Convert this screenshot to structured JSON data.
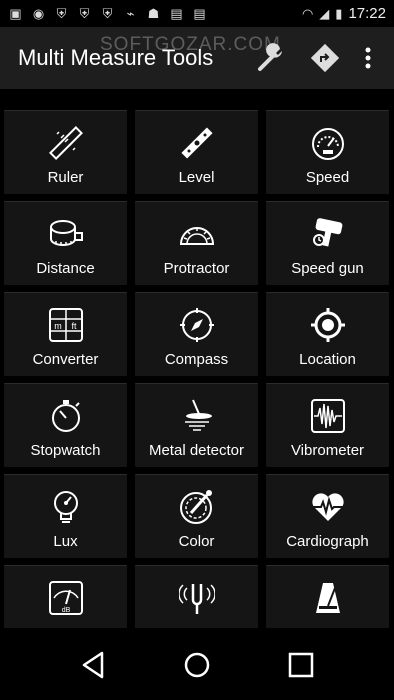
{
  "status_bar": {
    "time": "17:22"
  },
  "app_bar": {
    "title": "Multi Measure Tools",
    "watermark": "SOFTGOZAR.COM"
  },
  "tools": [
    {
      "label": "Ruler",
      "icon": "ruler-icon"
    },
    {
      "label": "Level",
      "icon": "level-icon"
    },
    {
      "label": "Speed",
      "icon": "speedometer-icon"
    },
    {
      "label": "Distance",
      "icon": "tape-measure-icon"
    },
    {
      "label": "Protractor",
      "icon": "protractor-icon"
    },
    {
      "label": "Speed gun",
      "icon": "speed-gun-icon"
    },
    {
      "label": "Converter",
      "icon": "converter-icon"
    },
    {
      "label": "Compass",
      "icon": "compass-icon"
    },
    {
      "label": "Location",
      "icon": "location-target-icon"
    },
    {
      "label": "Stopwatch",
      "icon": "stopwatch-icon"
    },
    {
      "label": "Metal detector",
      "icon": "metal-detector-icon"
    },
    {
      "label": "Vibrometer",
      "icon": "vibrometer-icon"
    },
    {
      "label": "Lux",
      "icon": "lux-bulb-icon"
    },
    {
      "label": "Color",
      "icon": "color-picker-icon"
    },
    {
      "label": "Cardiograph",
      "icon": "heartbeat-icon"
    },
    {
      "label": "",
      "icon": "sound-meter-icon"
    },
    {
      "label": "",
      "icon": "tuning-fork-icon"
    },
    {
      "label": "",
      "icon": "metronome-icon"
    }
  ],
  "converter_icon_text": [
    "m",
    "ft"
  ],
  "sound_meter_icon_text": "dB"
}
